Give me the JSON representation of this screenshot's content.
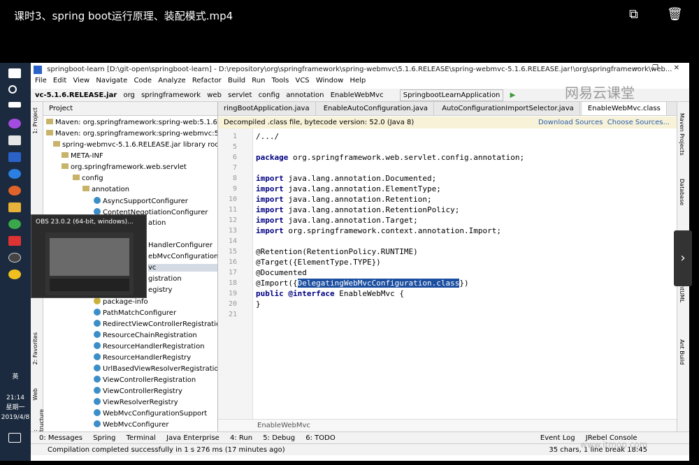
{
  "video": {
    "title": "课时3、spring boot运行原理、装配模式.mp4",
    "watermark_logo": "网易云课堂",
    "watermark_site": "www.itmop.com"
  },
  "taskbar": {
    "ime": "英",
    "time": "21:14",
    "weekday": "星期一",
    "date": "2019/4/8"
  },
  "ide": {
    "window_title": "springboot-learn [D:\\git-open\\springboot-learn] - D:\\repository\\org\\springframework\\spring-webmvc\\5.1.6.RELEASE\\spring-webmvc-5.1.6.RELEASE.jar!\\org\\springframework\\web...",
    "menu": [
      "File",
      "Edit",
      "View",
      "Navigate",
      "Code",
      "Analyze",
      "Refactor",
      "Build",
      "Run",
      "Tools",
      "VCS",
      "Window",
      "Help"
    ],
    "nav": [
      "vc-5.1.6.RELEASE.jar",
      "org",
      "springframework",
      "web",
      "servlet",
      "config",
      "annotation",
      "EnableWebMvc",
      "SpringbootLearnApplication"
    ],
    "project_header": "Project",
    "tree": [
      "Maven: org.springframework:spring-web:5.1.6.RELEA",
      "Maven: org.springframework:spring-webmvc:5.1.6.RE",
      "spring-webmvc-5.1.6.RELEASE.jar library root",
      "META-INF",
      "org.springframework.web.servlet",
      "config",
      "annotation",
      "AsyncSupportConfigurer",
      "ContentNegotiationConfigurer",
      "package-info",
      "PathMatchConfigurer",
      "RedirectViewControllerRegistration",
      "ResourceChainRegistration",
      "ResourceHandlerRegistration",
      "ResourceHandlerRegistry",
      "UrlBasedViewResolverRegistration",
      "ViewControllerRegistration",
      "ViewControllerRegistry",
      "ViewResolverRegistry",
      "WebMvcConfigurationSupport",
      "WebMvcConfigurer"
    ],
    "partial_tree": [
      "ation",
      "HandlerConfigurer",
      "ebMvcConfiguration",
      "vc",
      "gistration",
      "egistry"
    ],
    "obs_title": "OBS 23.0.2 (64-bit, windows)...",
    "tabs": [
      "ringBootApplication.java",
      "EnableAutoConfiguration.java",
      "AutoConfigurationImportSelector.java",
      "EnableWebMvc.class"
    ],
    "notice": "Decompiled .class file, bytecode version: 52.0 (Java 8)",
    "notice_link1": "Download Sources",
    "notice_link2": "Choose Sources...",
    "line_numbers": [
      "1",
      "5",
      "6",
      "7",
      "8",
      "9",
      "10",
      "11",
      "12",
      "13",
      "14",
      "15",
      "16",
      "17",
      "18",
      "19",
      "20",
      "21"
    ],
    "code": [
      "/.../",
      "",
      "package org.springframework.web.servlet.config.annotation;",
      "",
      "import java.lang.annotation.Documented;",
      "import java.lang.annotation.ElementType;",
      "import java.lang.annotation.Retention;",
      "import java.lang.annotation.RetentionPolicy;",
      "import java.lang.annotation.Target;",
      "import org.springframework.context.annotation.Import;",
      "",
      "@Retention(RetentionPolicy.RUNTIME)",
      "@Target({ElementType.TYPE})",
      "@Documented",
      "@Import({DelegatingWebMvcConfiguration.class})",
      "public @interface EnableWebMvc {",
      "}",
      ""
    ],
    "breadcrumb": "EnableWebMvc",
    "left_tools": [
      "1: Project",
      "2: Favorites",
      "Web",
      "Z: Structure"
    ],
    "right_tools": [
      "Maven Projects",
      "Database",
      "PlantUML",
      "Ant Build"
    ],
    "tool_windows": [
      "0: Messages",
      "Spring",
      "Terminal",
      "Java Enterprise",
      "4: Run",
      "5: Debug",
      "6: TODO",
      "Event Log",
      "JRebel Console"
    ],
    "status": "Compilation completed successfully in 1 s 276 ms (17 minutes ago)",
    "status_pos": "35 chars, 1 line break  18:45"
  }
}
